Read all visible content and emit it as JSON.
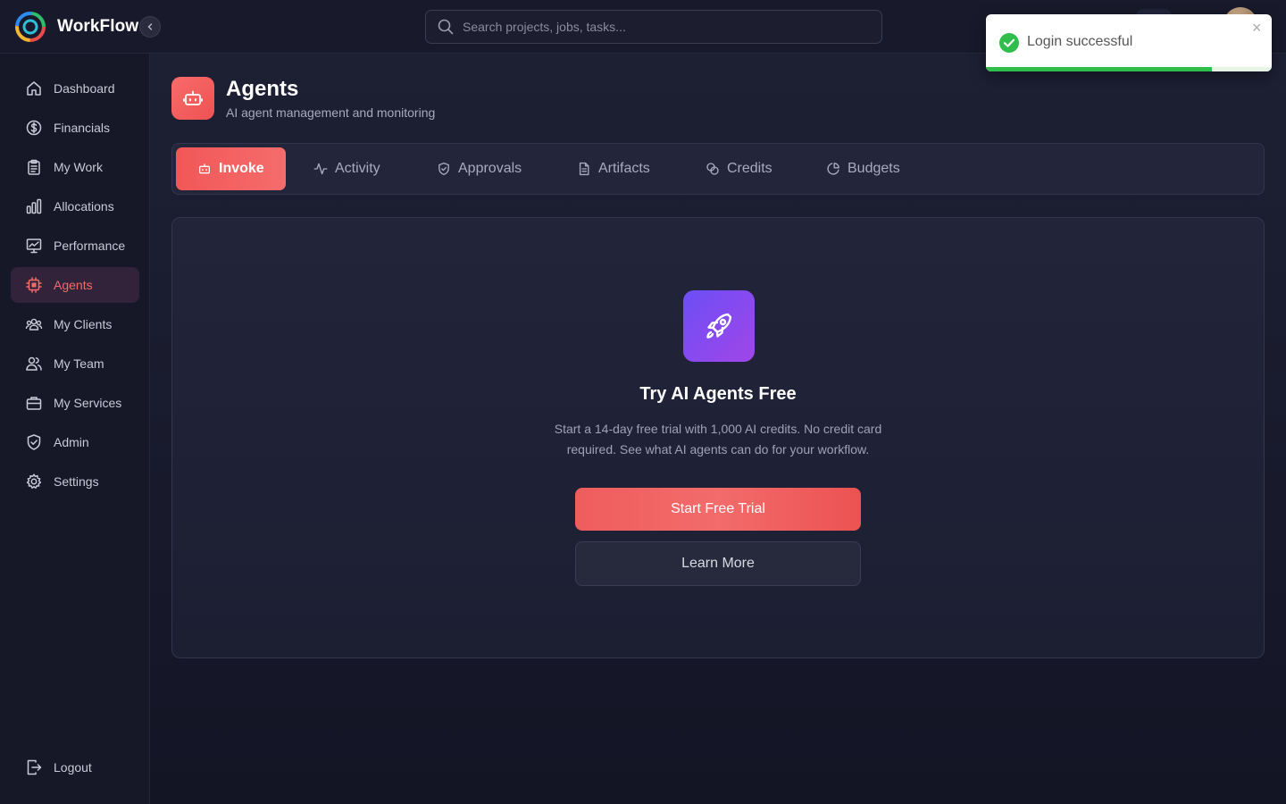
{
  "app": {
    "name": "WorkFlow"
  },
  "search": {
    "placeholder": "Search projects, jobs, tasks..."
  },
  "sidebar": {
    "items": [
      {
        "label": "Dashboard",
        "icon": "home-icon"
      },
      {
        "label": "Financials",
        "icon": "dollar-icon"
      },
      {
        "label": "My Work",
        "icon": "clipboard-icon"
      },
      {
        "label": "Allocations",
        "icon": "bar-chart-icon"
      },
      {
        "label": "Performance",
        "icon": "line-chart-icon"
      },
      {
        "label": "Agents",
        "icon": "cpu-icon",
        "active": true
      },
      {
        "label": "My Clients",
        "icon": "users-group-icon"
      },
      {
        "label": "My Team",
        "icon": "users-icon"
      },
      {
        "label": "My Services",
        "icon": "briefcase-icon"
      },
      {
        "label": "Admin",
        "icon": "shield-check-icon"
      },
      {
        "label": "Settings",
        "icon": "gear-icon"
      }
    ],
    "logout": {
      "label": "Logout",
      "icon": "logout-icon"
    }
  },
  "page": {
    "title": "Agents",
    "subtitle": "AI agent management and monitoring",
    "icon": "robot-icon"
  },
  "tabs": [
    {
      "label": "Invoke",
      "icon": "robot-icon",
      "active": true
    },
    {
      "label": "Activity",
      "icon": "activity-icon"
    },
    {
      "label": "Approvals",
      "icon": "shield-icon"
    },
    {
      "label": "Artifacts",
      "icon": "document-icon"
    },
    {
      "label": "Credits",
      "icon": "coins-icon"
    },
    {
      "label": "Budgets",
      "icon": "pie-chart-icon"
    }
  ],
  "trial_card": {
    "icon": "rocket-icon",
    "title": "Try AI Agents Free",
    "description": "Start a 14-day free trial with 1,000 AI credits. No credit card required. See what AI agents can do for your workflow.",
    "primary_button": "Start Free Trial",
    "secondary_button": "Learn More"
  },
  "toast": {
    "message": "Login successful",
    "progress_percent": 79,
    "close_symbol": "×"
  },
  "colors": {
    "accent": "#f25757",
    "active_nav_bg": "#33233a",
    "background": "#161727",
    "success": "#2fbd4b",
    "rocket_gradient_start": "#6c4ef6",
    "rocket_gradient_end": "#a046e8"
  }
}
